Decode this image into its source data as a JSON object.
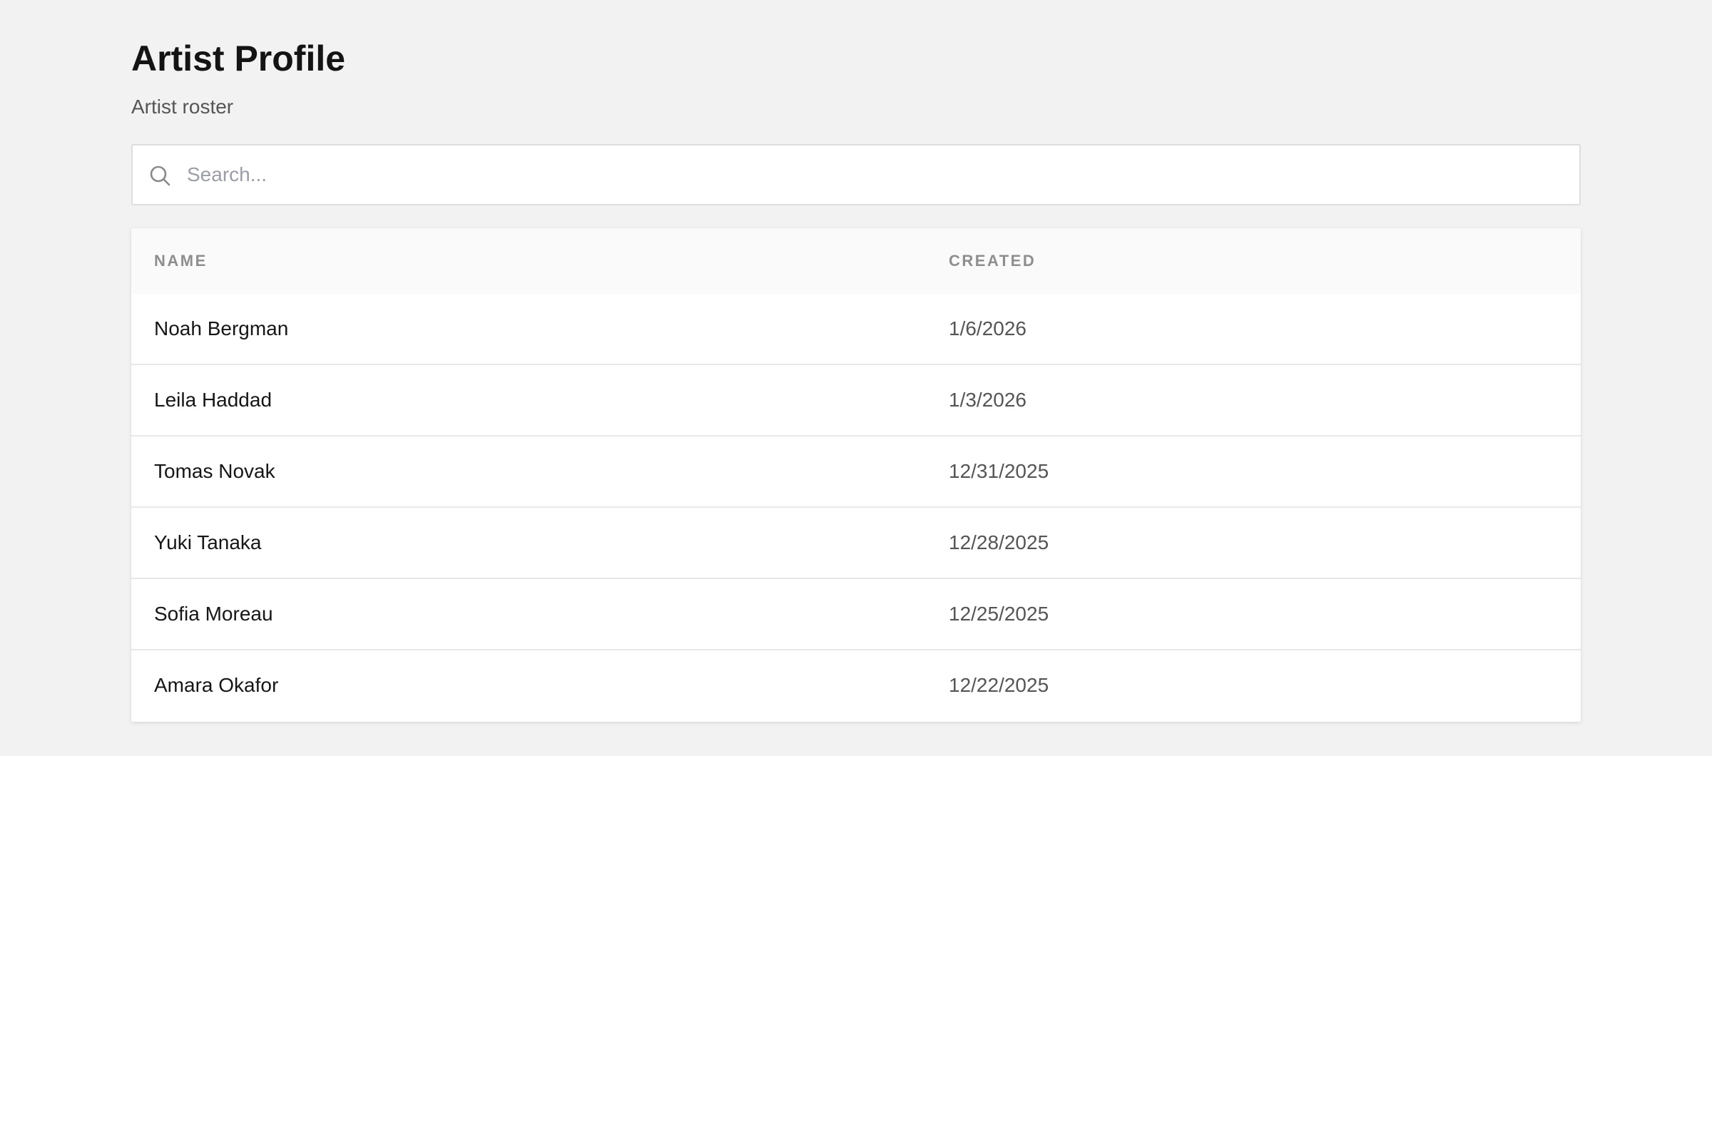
{
  "header": {
    "title": "Artist Profile",
    "subtitle": "Artist roster"
  },
  "search": {
    "placeholder": "Search...",
    "value": "",
    "icon": "search-icon"
  },
  "table": {
    "columns": [
      "NAME",
      "CREATED"
    ],
    "rows": [
      {
        "name": "Noah Bergman",
        "created": "1/6/2026"
      },
      {
        "name": "Leila Haddad",
        "created": "1/3/2026"
      },
      {
        "name": "Tomas Novak",
        "created": "12/31/2025"
      },
      {
        "name": "Yuki Tanaka",
        "created": "12/28/2025"
      },
      {
        "name": "Sofia Moreau",
        "created": "12/25/2025"
      },
      {
        "name": "Amara Okafor",
        "created": "12/22/2025"
      }
    ]
  },
  "colors": {
    "page_background": "#f2f2f2",
    "card_background": "#ffffff",
    "header_background": "#fafafa",
    "title_text": "#141414",
    "muted_text": "#555555",
    "column_header_text": "#8e8e8e"
  }
}
